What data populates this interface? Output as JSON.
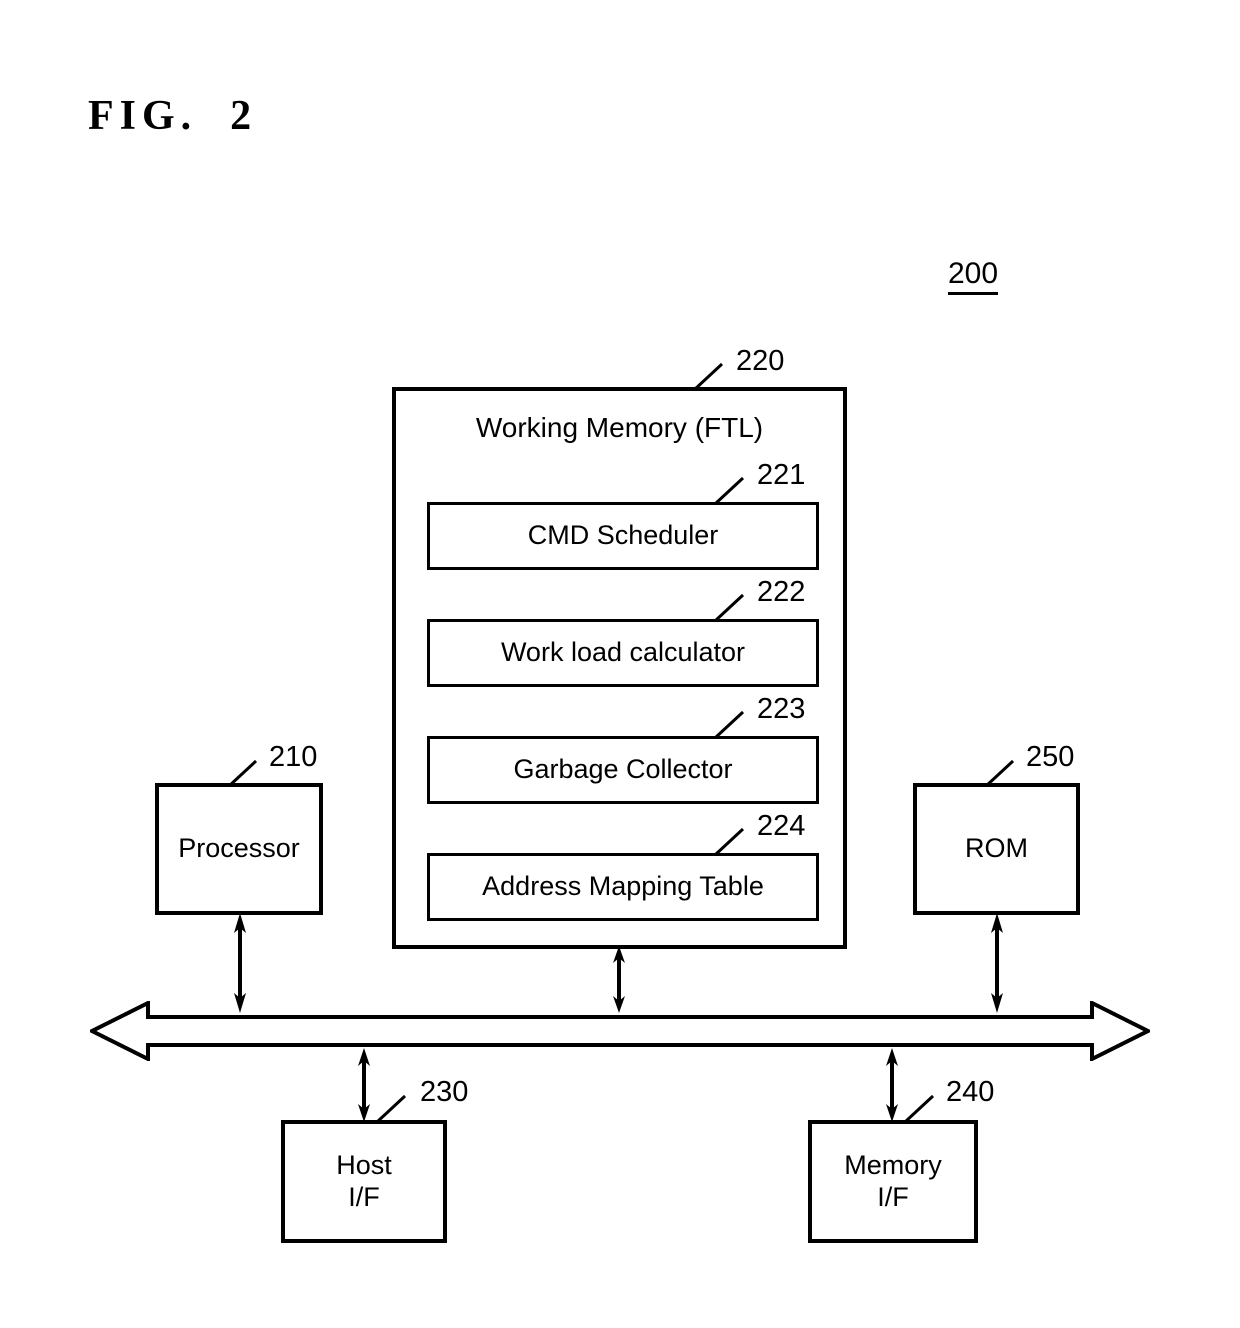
{
  "figure": {
    "title": "FIG.  2",
    "reference_number": "200"
  },
  "working_memory": {
    "label": "Working Memory (FTL)",
    "ref": "220",
    "modules": [
      {
        "label": "CMD Scheduler",
        "ref": "221"
      },
      {
        "label": "Work load calculator",
        "ref": "222"
      },
      {
        "label": "Garbage Collector",
        "ref": "223"
      },
      {
        "label": "Address Mapping Table",
        "ref": "224"
      }
    ]
  },
  "blocks": {
    "processor": {
      "label": "Processor",
      "ref": "210"
    },
    "rom": {
      "label": "ROM",
      "ref": "250"
    },
    "host_if": {
      "label": "Host\nI/F",
      "ref": "230"
    },
    "memory_if": {
      "label": "Memory\nI/F",
      "ref": "240"
    }
  },
  "bus": {
    "name": "system-bus",
    "direction": "bidirectional"
  },
  "colors": {
    "line": "#000000",
    "background": "#ffffff"
  }
}
